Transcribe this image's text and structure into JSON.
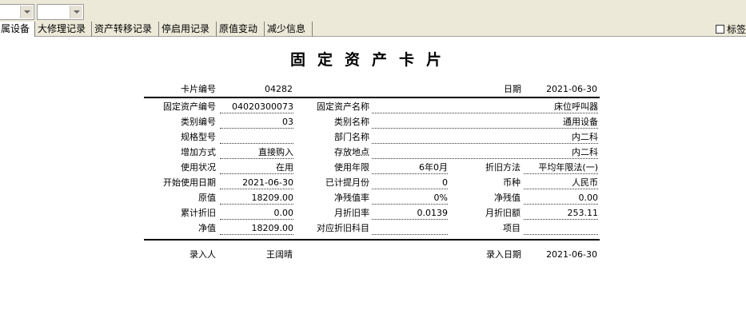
{
  "tabs": [
    {
      "label": "属设备",
      "active": true
    },
    {
      "label": "大修理记录",
      "active": false
    },
    {
      "label": "资产转移记录",
      "active": false
    },
    {
      "label": "停启用记录",
      "active": false
    },
    {
      "label": "原值变动",
      "active": false
    },
    {
      "label": "减少信息",
      "active": false
    }
  ],
  "tag_toggle_label": "标签",
  "card": {
    "title": "固定资产卡片",
    "header": {
      "card_no_label": "卡片编号",
      "card_no": "04282",
      "date_label": "日期",
      "date": "2021-06-30"
    },
    "fields": {
      "asset_no_label": "固定资产编号",
      "asset_no": "04020300073",
      "asset_name_label": "固定资产名称",
      "asset_name": "床位呼叫器",
      "category_no_label": "类别编号",
      "category_no": "03",
      "category_name_label": "类别名称",
      "category_name": "通用设备",
      "model_label": "规格型号",
      "model": "",
      "dept_label": "部门名称",
      "dept": "内二科",
      "add_method_label": "增加方式",
      "add_method": "直接购入",
      "location_label": "存放地点",
      "location": "内二科",
      "status_label": "使用状况",
      "status": "在用",
      "life_label": "使用年限",
      "life": "6年0月",
      "dep_method_label": "折旧方法",
      "dep_method": "平均年限法(一)",
      "start_date_label": "开始使用日期",
      "start_date": "2021-06-30",
      "months_label": "已计提月份",
      "months": "0",
      "currency_label": "币种",
      "currency": "人民币",
      "orig_value_label": "原值",
      "orig_value": "18209.00",
      "residual_rate_label": "净残值率",
      "residual_rate": "0%",
      "residual_label": "净残值",
      "residual": "0.00",
      "acc_dep_label": "累计折旧",
      "acc_dep": "0.00",
      "monthly_rate_label": "月折旧率",
      "monthly_rate": "0.0139",
      "monthly_amount_label": "月折旧额",
      "monthly_amount": "253.11",
      "net_value_label": "净值",
      "net_value": "18209.00",
      "dep_account_label": "对应折旧科目",
      "dep_account": "",
      "project_label": "项目",
      "project": ""
    },
    "footer": {
      "entered_by_label": "录入人",
      "entered_by": "王阔晴",
      "entry_date_label": "录入日期",
      "entry_date": "2021-06-30"
    }
  }
}
